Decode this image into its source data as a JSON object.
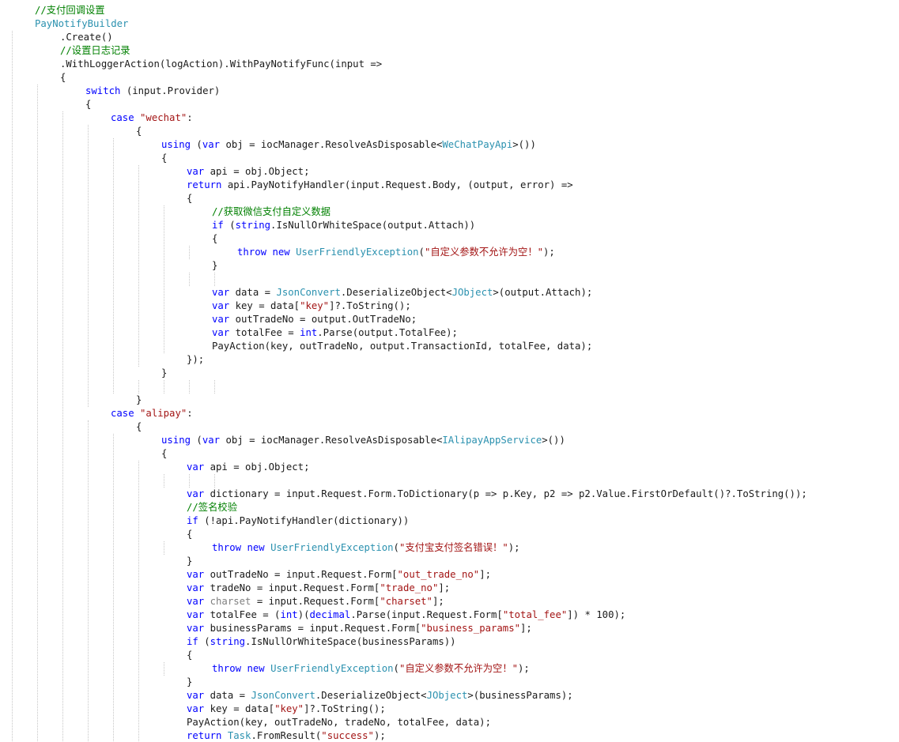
{
  "palette": {
    "text": "#1a1a1a",
    "keyword": "#0000ff",
    "type": "#2b91af",
    "string": "#a31515",
    "comment": "#008000",
    "muted": "#808080"
  },
  "lines": [
    [
      {
        "t": "//支付回调设置",
        "k": "comment"
      }
    ],
    [
      {
        "t": "PayNotifyBuilder",
        "k": "type"
      }
    ],
    [
      {
        "t": "    .Create()",
        "k": "text"
      }
    ],
    [
      {
        "t": "    //设置日志记录",
        "k": "comment"
      }
    ],
    [
      {
        "t": "    .WithLoggerAction(logAction).WithPayNotifyFunc(input =>",
        "k": "text"
      }
    ],
    [
      {
        "t": "    {",
        "k": "text"
      }
    ],
    [
      {
        "t": "        ",
        "k": "text"
      },
      {
        "t": "switch",
        "k": "keyword"
      },
      {
        "t": " (input.Provider)",
        "k": "text"
      }
    ],
    [
      {
        "t": "        {",
        "k": "text"
      }
    ],
    [
      {
        "t": "            ",
        "k": "text"
      },
      {
        "t": "case",
        "k": "keyword"
      },
      {
        "t": " ",
        "k": "text"
      },
      {
        "t": "\"wechat\"",
        "k": "string"
      },
      {
        "t": ":",
        "k": "text"
      }
    ],
    [
      {
        "t": "                {",
        "k": "text"
      }
    ],
    [
      {
        "t": "                    ",
        "k": "text"
      },
      {
        "t": "using",
        "k": "keyword"
      },
      {
        "t": " (",
        "k": "text"
      },
      {
        "t": "var",
        "k": "keyword"
      },
      {
        "t": " obj = iocManager.ResolveAsDisposable<",
        "k": "text"
      },
      {
        "t": "WeChatPayApi",
        "k": "type"
      },
      {
        "t": ">())",
        "k": "text"
      }
    ],
    [
      {
        "t": "                    {",
        "k": "text"
      }
    ],
    [
      {
        "t": "                        ",
        "k": "text"
      },
      {
        "t": "var",
        "k": "keyword"
      },
      {
        "t": " api = obj.Object;",
        "k": "text"
      }
    ],
    [
      {
        "t": "                        ",
        "k": "text"
      },
      {
        "t": "return",
        "k": "keyword"
      },
      {
        "t": " api.PayNotifyHandler(input.Request.Body, (output, error) =>",
        "k": "text"
      }
    ],
    [
      {
        "t": "                        {",
        "k": "text"
      }
    ],
    [
      {
        "t": "                            //获取微信支付自定义数据",
        "k": "comment"
      }
    ],
    [
      {
        "t": "                            ",
        "k": "text"
      },
      {
        "t": "if",
        "k": "keyword"
      },
      {
        "t": " (",
        "k": "text"
      },
      {
        "t": "string",
        "k": "keyword"
      },
      {
        "t": ".IsNullOrWhiteSpace(output.Attach))",
        "k": "text"
      }
    ],
    [
      {
        "t": "                            {",
        "k": "text"
      }
    ],
    [
      {
        "t": "                                ",
        "k": "text"
      },
      {
        "t": "throw",
        "k": "keyword"
      },
      {
        "t": " ",
        "k": "text"
      },
      {
        "t": "new",
        "k": "keyword"
      },
      {
        "t": " ",
        "k": "text"
      },
      {
        "t": "UserFriendlyException",
        "k": "type"
      },
      {
        "t": "(",
        "k": "text"
      },
      {
        "t": "\"自定义参数不允许为空！\"",
        "k": "string"
      },
      {
        "t": ");",
        "k": "text"
      }
    ],
    [
      {
        "t": "                            }",
        "k": "text"
      }
    ],
    [
      {
        "t": "",
        "k": "text"
      }
    ],
    [
      {
        "t": "                            ",
        "k": "text"
      },
      {
        "t": "var",
        "k": "keyword"
      },
      {
        "t": " data = ",
        "k": "text"
      },
      {
        "t": "JsonConvert",
        "k": "type"
      },
      {
        "t": ".DeserializeObject<",
        "k": "text"
      },
      {
        "t": "JObject",
        "k": "type"
      },
      {
        "t": ">(output.Attach);",
        "k": "text"
      }
    ],
    [
      {
        "t": "                            ",
        "k": "text"
      },
      {
        "t": "var",
        "k": "keyword"
      },
      {
        "t": " key = data[",
        "k": "text"
      },
      {
        "t": "\"key\"",
        "k": "string"
      },
      {
        "t": "]?.ToString();",
        "k": "text"
      }
    ],
    [
      {
        "t": "                            ",
        "k": "text"
      },
      {
        "t": "var",
        "k": "keyword"
      },
      {
        "t": " outTradeNo = output.OutTradeNo;",
        "k": "text"
      }
    ],
    [
      {
        "t": "                            ",
        "k": "text"
      },
      {
        "t": "var",
        "k": "keyword"
      },
      {
        "t": " totalFee = ",
        "k": "text"
      },
      {
        "t": "int",
        "k": "keyword"
      },
      {
        "t": ".Parse(output.TotalFee);",
        "k": "text"
      }
    ],
    [
      {
        "t": "                            PayAction(key, outTradeNo, output.TransactionId, totalFee, data);",
        "k": "text"
      }
    ],
    [
      {
        "t": "                        });",
        "k": "text"
      }
    ],
    [
      {
        "t": "                    }",
        "k": "text"
      }
    ],
    [
      {
        "t": "",
        "k": "text"
      }
    ],
    [
      {
        "t": "                }",
        "k": "text"
      }
    ],
    [
      {
        "t": "            ",
        "k": "text"
      },
      {
        "t": "case",
        "k": "keyword"
      },
      {
        "t": " ",
        "k": "text"
      },
      {
        "t": "\"alipay\"",
        "k": "string"
      },
      {
        "t": ":",
        "k": "text"
      }
    ],
    [
      {
        "t": "                {",
        "k": "text"
      }
    ],
    [
      {
        "t": "                    ",
        "k": "text"
      },
      {
        "t": "using",
        "k": "keyword"
      },
      {
        "t": " (",
        "k": "text"
      },
      {
        "t": "var",
        "k": "keyword"
      },
      {
        "t": " obj = iocManager.ResolveAsDisposable<",
        "k": "text"
      },
      {
        "t": "IAlipayAppService",
        "k": "type"
      },
      {
        "t": ">())",
        "k": "text"
      }
    ],
    [
      {
        "t": "                    {",
        "k": "text"
      }
    ],
    [
      {
        "t": "                        ",
        "k": "text"
      },
      {
        "t": "var",
        "k": "keyword"
      },
      {
        "t": " api = obj.Object;",
        "k": "text"
      }
    ],
    [
      {
        "t": "",
        "k": "text"
      }
    ],
    [
      {
        "t": "                        ",
        "k": "text"
      },
      {
        "t": "var",
        "k": "keyword"
      },
      {
        "t": " dictionary = input.Request.Form.ToDictionary(p => p.Key, p2 => p2.Value.FirstOrDefault()?.ToString());",
        "k": "text"
      }
    ],
    [
      {
        "t": "                        //签名校验",
        "k": "comment"
      }
    ],
    [
      {
        "t": "                        ",
        "k": "text"
      },
      {
        "t": "if",
        "k": "keyword"
      },
      {
        "t": " (!api.PayNotifyHandler(dictionary))",
        "k": "text"
      }
    ],
    [
      {
        "t": "                        {",
        "k": "text"
      }
    ],
    [
      {
        "t": "                            ",
        "k": "text"
      },
      {
        "t": "throw",
        "k": "keyword"
      },
      {
        "t": " ",
        "k": "text"
      },
      {
        "t": "new",
        "k": "keyword"
      },
      {
        "t": " ",
        "k": "text"
      },
      {
        "t": "UserFriendlyException",
        "k": "type"
      },
      {
        "t": "(",
        "k": "text"
      },
      {
        "t": "\"支付宝支付签名错误！\"",
        "k": "string"
      },
      {
        "t": ");",
        "k": "text"
      }
    ],
    [
      {
        "t": "                        }",
        "k": "text"
      }
    ],
    [
      {
        "t": "                        ",
        "k": "text"
      },
      {
        "t": "var",
        "k": "keyword"
      },
      {
        "t": " outTradeNo = input.Request.Form[",
        "k": "text"
      },
      {
        "t": "\"out_trade_no\"",
        "k": "string"
      },
      {
        "t": "];",
        "k": "text"
      }
    ],
    [
      {
        "t": "                        ",
        "k": "text"
      },
      {
        "t": "var",
        "k": "keyword"
      },
      {
        "t": " tradeNo = input.Request.Form[",
        "k": "text"
      },
      {
        "t": "\"trade_no\"",
        "k": "string"
      },
      {
        "t": "];",
        "k": "text"
      }
    ],
    [
      {
        "t": "                        ",
        "k": "text"
      },
      {
        "t": "var",
        "k": "keyword"
      },
      {
        "t": " ",
        "k": "text"
      },
      {
        "t": "charset",
        "k": "muted"
      },
      {
        "t": " = input.Request.Form[",
        "k": "text"
      },
      {
        "t": "\"charset\"",
        "k": "string"
      },
      {
        "t": "];",
        "k": "text"
      }
    ],
    [
      {
        "t": "                        ",
        "k": "text"
      },
      {
        "t": "var",
        "k": "keyword"
      },
      {
        "t": " totalFee = (",
        "k": "text"
      },
      {
        "t": "int",
        "k": "keyword"
      },
      {
        "t": ")(",
        "k": "text"
      },
      {
        "t": "decimal",
        "k": "keyword"
      },
      {
        "t": ".Parse(input.Request.Form[",
        "k": "text"
      },
      {
        "t": "\"total_fee\"",
        "k": "string"
      },
      {
        "t": "]) * 100);",
        "k": "text"
      }
    ],
    [
      {
        "t": "                        ",
        "k": "text"
      },
      {
        "t": "var",
        "k": "keyword"
      },
      {
        "t": " businessParams = input.Request.Form[",
        "k": "text"
      },
      {
        "t": "\"business_params\"",
        "k": "string"
      },
      {
        "t": "];",
        "k": "text"
      }
    ],
    [
      {
        "t": "                        ",
        "k": "text"
      },
      {
        "t": "if",
        "k": "keyword"
      },
      {
        "t": " (",
        "k": "text"
      },
      {
        "t": "string",
        "k": "keyword"
      },
      {
        "t": ".IsNullOrWhiteSpace(businessParams))",
        "k": "text"
      }
    ],
    [
      {
        "t": "                        {",
        "k": "text"
      }
    ],
    [
      {
        "t": "                            ",
        "k": "text"
      },
      {
        "t": "throw",
        "k": "keyword"
      },
      {
        "t": " ",
        "k": "text"
      },
      {
        "t": "new",
        "k": "keyword"
      },
      {
        "t": " ",
        "k": "text"
      },
      {
        "t": "UserFriendlyException",
        "k": "type"
      },
      {
        "t": "(",
        "k": "text"
      },
      {
        "t": "\"自定义参数不允许为空！\"",
        "k": "string"
      },
      {
        "t": ");",
        "k": "text"
      }
    ],
    [
      {
        "t": "                        }",
        "k": "text"
      }
    ],
    [
      {
        "t": "                        ",
        "k": "text"
      },
      {
        "t": "var",
        "k": "keyword"
      },
      {
        "t": " data = ",
        "k": "text"
      },
      {
        "t": "JsonConvert",
        "k": "type"
      },
      {
        "t": ".DeserializeObject<",
        "k": "text"
      },
      {
        "t": "JObject",
        "k": "type"
      },
      {
        "t": ">(businessParams);",
        "k": "text"
      }
    ],
    [
      {
        "t": "                        ",
        "k": "text"
      },
      {
        "t": "var",
        "k": "keyword"
      },
      {
        "t": " key = data[",
        "k": "text"
      },
      {
        "t": "\"key\"",
        "k": "string"
      },
      {
        "t": "]?.ToString();",
        "k": "text"
      }
    ],
    [
      {
        "t": "                        PayAction(key, outTradeNo, tradeNo, totalFee, data);",
        "k": "text"
      }
    ],
    [
      {
        "t": "                        ",
        "k": "text"
      },
      {
        "t": "return",
        "k": "keyword"
      },
      {
        "t": " ",
        "k": "text"
      },
      {
        "t": "Task",
        "k": "type"
      },
      {
        "t": ".FromResult(",
        "k": "text"
      },
      {
        "t": "\"success\"",
        "k": "string"
      },
      {
        "t": ");",
        "k": "text"
      }
    ]
  ]
}
